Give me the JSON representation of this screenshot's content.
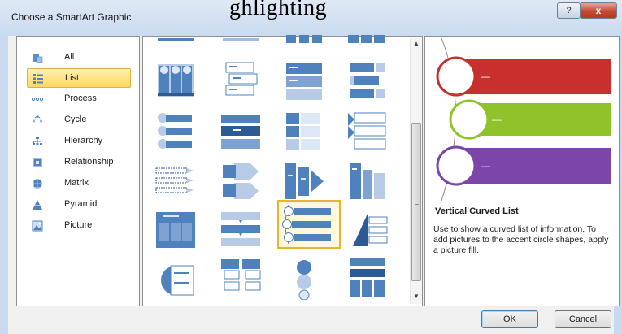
{
  "window": {
    "title": "Choose a SmartArt Graphic",
    "handwritten_overlay": "ghlighting"
  },
  "titlebar_buttons": {
    "help": "?",
    "close": "x"
  },
  "categories": [
    {
      "label": "All",
      "icon": "all-icon"
    },
    {
      "label": "List",
      "icon": "list-icon",
      "selected": true
    },
    {
      "label": "Process",
      "icon": "process-icon"
    },
    {
      "label": "Cycle",
      "icon": "cycle-icon"
    },
    {
      "label": "Hierarchy",
      "icon": "hierarchy-icon"
    },
    {
      "label": "Relationship",
      "icon": "relationship-icon"
    },
    {
      "label": "Matrix",
      "icon": "matrix-icon"
    },
    {
      "label": "Pyramid",
      "icon": "pyramid-icon"
    },
    {
      "label": "Picture",
      "icon": "picture-icon"
    }
  ],
  "gallery": {
    "selected_layout": "Vertical Curved List"
  },
  "preview": {
    "name": "Vertical Curved List",
    "description": "Use to show a curved list of information. To add pictures to the accent circle shapes, apply a picture fill.",
    "bar_colors": [
      "#c8302d",
      "#8fc32a",
      "#7b46a8"
    ],
    "bar_text": "—"
  },
  "buttons": {
    "ok": "OK",
    "cancel": "Cancel"
  },
  "colors": {
    "accent_blue": "#4f81bd",
    "selection_gold": "#ffd75f"
  }
}
